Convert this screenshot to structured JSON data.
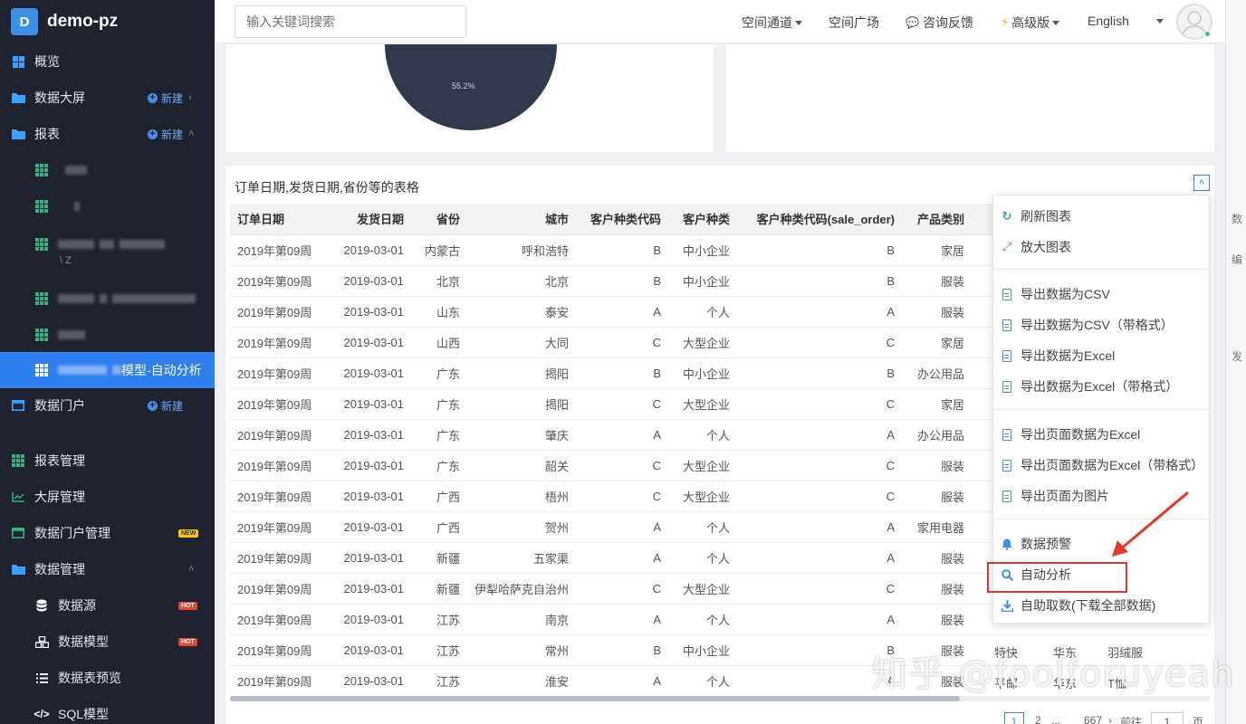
{
  "brand": {
    "logo_letter": "D",
    "name": "demo-pz"
  },
  "sidebar": {
    "overview": "概览",
    "data_screen": "数据大屏",
    "reports": "报表",
    "new_label": "新建",
    "report_children": [
      "",
      "",
      "",
      "",
      ""
    ],
    "report_child_suffix": "\\ Z",
    "active_report": "模型-自动分析",
    "data_portal": "数据门户",
    "report_manage": "报表管理",
    "screen_manage": "大屏管理",
    "portal_manage": "数据门户管理",
    "data_manage": "数据管理",
    "datasource": "数据源",
    "data_model": "数据模型",
    "table_preview": "数据表预览",
    "sql_model": "SQL模型",
    "badge_new": "NEW",
    "badge_hot": "HOT",
    "accent_color": "#2f7ff0"
  },
  "topbar": {
    "search_placeholder": "输入关键词搜索",
    "space_channel": "空间通道",
    "space_square": "空间广场",
    "feedback": "咨询反馈",
    "premium": "高级版",
    "language": "English"
  },
  "chart_fragment": {
    "pie_label": "55.2%"
  },
  "table": {
    "title": "订单日期,发货日期,省份等的表格",
    "columns": [
      "订单日期",
      "发货日期",
      "省份",
      "城市",
      "客户种类代码",
      "客户种类",
      "客户种类代码(sale_order)",
      "产品类别"
    ],
    "rows": [
      [
        "2019年第09周",
        "2019-03-01",
        "内蒙古",
        "呼和浩特",
        "B",
        "中小企业",
        "B",
        "家居"
      ],
      [
        "2019年第09周",
        "2019-03-01",
        "北京",
        "北京",
        "B",
        "中小企业",
        "B",
        "服装"
      ],
      [
        "2019年第09周",
        "2019-03-01",
        "山东",
        "泰安",
        "A",
        "个人",
        "A",
        "服装"
      ],
      [
        "2019年第09周",
        "2019-03-01",
        "山西",
        "大同",
        "C",
        "大型企业",
        "C",
        "家居"
      ],
      [
        "2019年第09周",
        "2019-03-01",
        "广东",
        "揭阳",
        "B",
        "中小企业",
        "B",
        "办公用品"
      ],
      [
        "2019年第09周",
        "2019-03-01",
        "广东",
        "揭阳",
        "C",
        "大型企业",
        "C",
        "家居"
      ],
      [
        "2019年第09周",
        "2019-03-01",
        "广东",
        "肇庆",
        "A",
        "个人",
        "A",
        "办公用品"
      ],
      [
        "2019年第09周",
        "2019-03-01",
        "广东",
        "韶关",
        "C",
        "大型企业",
        "C",
        "服装"
      ],
      [
        "2019年第09周",
        "2019-03-01",
        "广西",
        "梧州",
        "C",
        "大型企业",
        "C",
        "服装"
      ],
      [
        "2019年第09周",
        "2019-03-01",
        "广西",
        "贺州",
        "A",
        "个人",
        "A",
        "家用电器"
      ],
      [
        "2019年第09周",
        "2019-03-01",
        "新疆",
        "五家渠",
        "A",
        "个人",
        "A",
        "服装"
      ],
      [
        "2019年第09周",
        "2019-03-01",
        "新疆",
        "伊犁哈萨克自治州",
        "C",
        "大型企业",
        "C",
        "服装"
      ],
      [
        "2019年第09周",
        "2019-03-01",
        "江苏",
        "南京",
        "A",
        "个人",
        "A",
        "服装"
      ],
      [
        "2019年第09周",
        "2019-03-01",
        "江苏",
        "常州",
        "B",
        "中小企业",
        "B",
        "服装"
      ],
      [
        "2019年第09周",
        "2019-03-01",
        "江苏",
        "淮安",
        "A",
        "个人",
        "A",
        "服装"
      ]
    ],
    "extra_visible": [
      [
        "特快",
        "华东",
        "羽绒服"
      ],
      [
        "平邮",
        "华东",
        "T恤"
      ]
    ]
  },
  "pagination": {
    "current": "1",
    "next_page": "2",
    "ellipsis": "...",
    "last": "667",
    "goto_label": "前往",
    "goto_value": "1",
    "page_unit": "页"
  },
  "menu": {
    "refresh": "刷新图表",
    "enlarge": "放大图表",
    "export_csv": "导出数据为CSV",
    "export_csv_fmt": "导出数据为CSV（带格式）",
    "export_excel": "导出数据为Excel",
    "export_excel_fmt": "导出数据为Excel（带格式）",
    "export_page_excel": "导出页面数据为Excel",
    "export_page_excel_fmt": "导出页面数据为Excel（带格式）",
    "export_page_image": "导出页面为图片",
    "data_alert": "数据预警",
    "auto_analysis": "自动分析",
    "self_fetch": "自助取数(下载全部数据)"
  },
  "right_strip": [
    "数",
    "编",
    "发"
  ],
  "watermark": "知乎 @foolforuyeah",
  "annotation_color": "#e03a2e"
}
